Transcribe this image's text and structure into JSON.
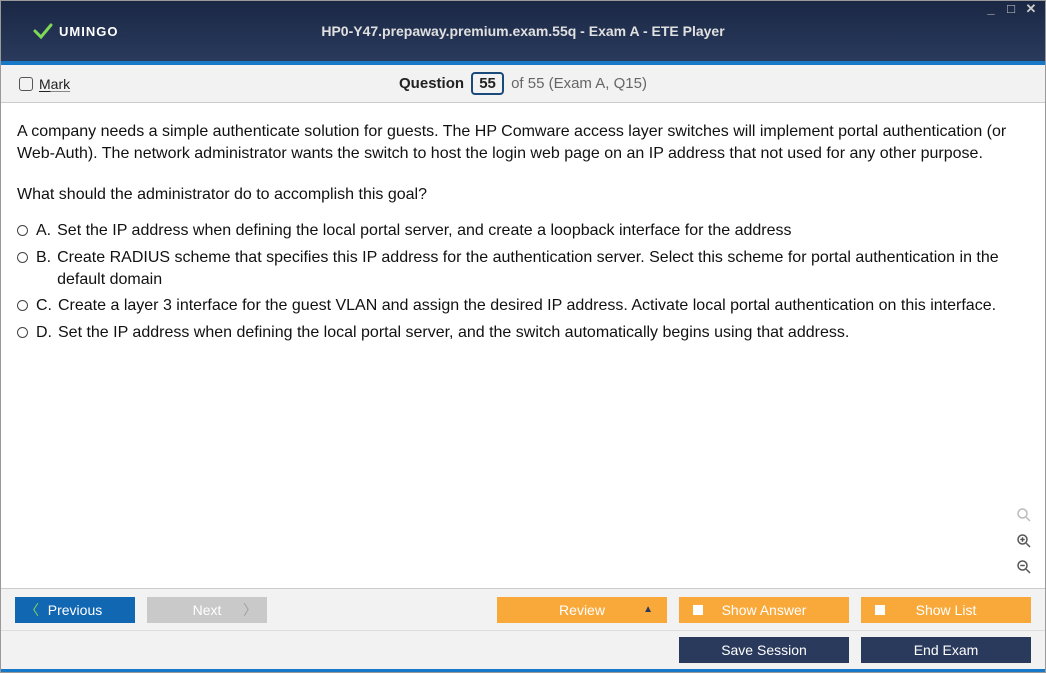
{
  "header": {
    "logo_text": "UMINGO",
    "title": "HP0-Y47.prepaway.premium.exam.55q - Exam A - ETE Player"
  },
  "subheader": {
    "mark_label": "Mark",
    "question_word": "Question",
    "current_num": "55",
    "of_text": "of 55 (Exam A, Q15)"
  },
  "question": {
    "body": "A company needs a simple authenticate solution for guests. The HP Comware access layer switches will implement portal authentication (or Web-Auth). The network administrator wants the switch to host the login web page on an IP address that not used for any other purpose.",
    "prompt": "What should the administrator do to accomplish this goal?",
    "answers": [
      {
        "letter": "A.",
        "text": "Set the IP address when defining the local portal server, and create a loopback interface for the address"
      },
      {
        "letter": "B.",
        "text": "Create RADIUS scheme that specifies this IP address for the authentication server. Select this scheme for portal authentication in the default domain"
      },
      {
        "letter": "C.",
        "text": "Create a layer 3 interface for the guest VLAN and assign the desired IP address. Activate local portal authentication on this interface."
      },
      {
        "letter": "D.",
        "text": "Set the IP address when defining the local portal server, and the switch automatically begins using that address."
      }
    ]
  },
  "footer": {
    "previous": "Previous",
    "next": "Next",
    "review": "Review",
    "show_answer": "Show Answer",
    "show_list": "Show List",
    "save_session": "Save Session",
    "end_exam": "End Exam"
  }
}
